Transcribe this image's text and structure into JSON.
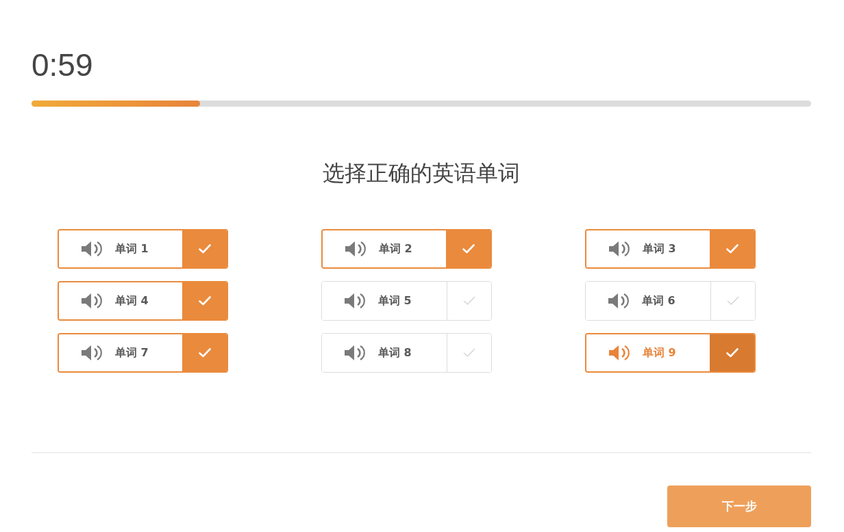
{
  "timer": "0:59",
  "progress": {
    "level": 0.216
  },
  "prompt": "选择正确的英语单词",
  "options": [
    {
      "label": "单词 1",
      "checked": true,
      "playing": false
    },
    {
      "label": "单词 2",
      "checked": true,
      "playing": false
    },
    {
      "label": "单词 3",
      "checked": true,
      "playing": false
    },
    {
      "label": "单词 4",
      "checked": true,
      "playing": false
    },
    {
      "label": "单词 5",
      "checked": false,
      "playing": false
    },
    {
      "label": "单词 6",
      "checked": false,
      "playing": false
    },
    {
      "label": "单词 7",
      "checked": true,
      "playing": false
    },
    {
      "label": "单词 8",
      "checked": false,
      "playing": false
    },
    {
      "label": "单词 9",
      "checked": true,
      "playing": true
    }
  ],
  "next_button": {
    "label": "下一步"
  }
}
